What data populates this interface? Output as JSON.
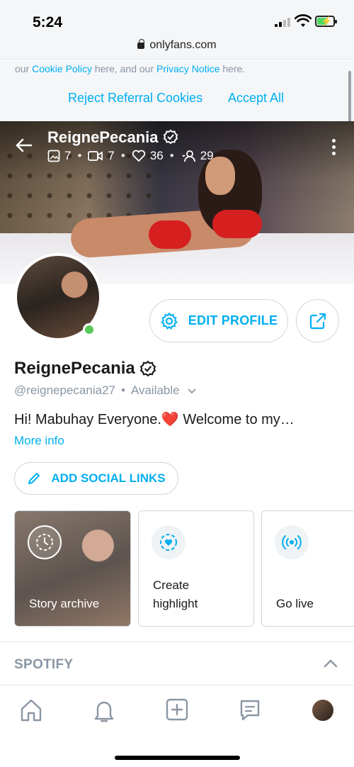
{
  "status_bar": {
    "time": "5:24",
    "url": "onlyfans.com"
  },
  "cookie_banner": {
    "text_prefix": "our ",
    "cookie_policy_link": "Cookie Policy",
    "text_middle": " here, and our ",
    "privacy_link": "Privacy Notice",
    "text_suffix": " here.",
    "reject_label": "Reject Referral Cookies",
    "accept_label": "Accept All"
  },
  "cover": {
    "name": "ReignePecania",
    "stats": {
      "photos": "7",
      "videos": "7",
      "likes": "36",
      "fans": "29"
    }
  },
  "profile": {
    "edit_label": "EDIT PROFILE",
    "name": "ReignePecania",
    "handle": "@reignepecania27",
    "availability": "Available",
    "bio_start": "Hi! Mabuhay Everyone.",
    "bio_heart": "❤️",
    "bio_end": " Welcome to my…",
    "more_info": "More info",
    "social_label": "ADD SOCIAL LINKS"
  },
  "cards": {
    "story": "Story archive",
    "highlight_line1": "Create",
    "highlight_line2": "highlight",
    "golive": "Go live"
  },
  "spotify": {
    "label": "SPOTIFY"
  },
  "colors": {
    "accent": "#00aff0",
    "muted": "#8a96a3",
    "online": "#5ac85a"
  }
}
